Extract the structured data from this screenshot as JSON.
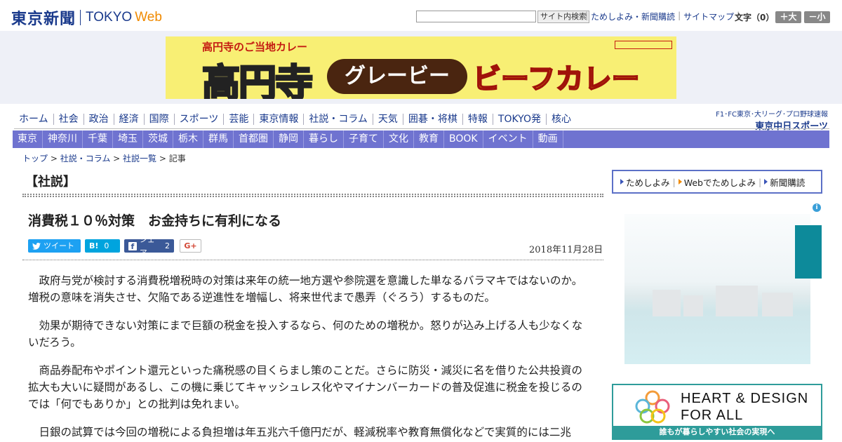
{
  "header": {
    "logo_jp": "東京新聞",
    "logo_tokyo": "TOKYO",
    "logo_web": "Web",
    "search_button": "サイト内検索",
    "links": [
      "ためしよみ・新聞購読",
      "サイトマップ"
    ],
    "font_size_label": "文字（0）",
    "font_up": "＋大",
    "font_down": "－小"
  },
  "banner": {
    "top_line": "高円寺のご当地カレー",
    "kouenji": "高円寺",
    "gravy": "グレービー",
    "beef": "ビーフカレー"
  },
  "nav_main": [
    "ホーム",
    "社会",
    "政治",
    "経済",
    "国際",
    "スポーツ",
    "芸能",
    "東京情報",
    "社説・コラム",
    "天気",
    "囲碁・将棋",
    "特報",
    "TOKYO発",
    "核心"
  ],
  "sports_link": {
    "top": "F1･FC東京･大リーグ･プロ野球速報",
    "logo": "東京中日スポーツ"
  },
  "nav_region": [
    "東京",
    "神奈川",
    "千葉",
    "埼玉",
    "茨城",
    "栃木",
    "群馬",
    "首都圏",
    "静岡",
    "暮らし",
    "子育て",
    "文化",
    "教育",
    "BOOK",
    "イベント",
    "動画"
  ],
  "breadcrumb": {
    "items": [
      "トップ",
      "社説・コラム",
      "社説一覧"
    ],
    "current": "記事"
  },
  "article": {
    "section": "【社説】",
    "headline": "消費税１０％対策　お金持ちに有利になる",
    "date": "2018年11月28日",
    "share": {
      "tweet": "ツイート",
      "hatena": "B!",
      "hatena_count": "0",
      "facebook": "シェア",
      "facebook_count": "2",
      "gplus": "G+"
    },
    "paragraphs": [
      "政府与党が検討する消費税増税時の対策は来年の統一地方選や参院選を意識した単なるバラマキではないのか。増税の意味を消失させ、欠陥である逆進性を増幅し、将来世代まで愚弄（ぐろう）するものだ。",
      "効果が期待できない対策にまで巨額の税金を投入するなら、何のための増税か。怒りが込み上げる人も少なくないだろう。",
      "商品券配布やポイント還元といった痛税感の目くらまし策のことだ。さらに防災・減災に名を借りた公共投資の拡大も大いに疑問があるし、この機に乗じてキャッシュレス化やマイナンバーカードの普及促進に税金を投じるのでは「何でもありか」との批判は免れまい。",
      "日銀の試算では今回の増税による負担増は年五兆六千億円だが、軽減税率や教育無償化などで実質的には二兆"
    ]
  },
  "sidebar": {
    "subscribe": [
      "ためしよみ",
      "Webでためしよみ",
      "新聞購読"
    ],
    "adchoice": "i",
    "hd_title1": "HEART & DESIGN",
    "hd_title2": "FOR ALL",
    "hd_band": "誰もが暮らしやすい社会の実現へ"
  },
  "colors": {
    "brand_blue": "#1a3a8c",
    "nav_purple": "#6f73d0",
    "web_orange": "#f08a00",
    "teal": "#2e9c9a"
  }
}
